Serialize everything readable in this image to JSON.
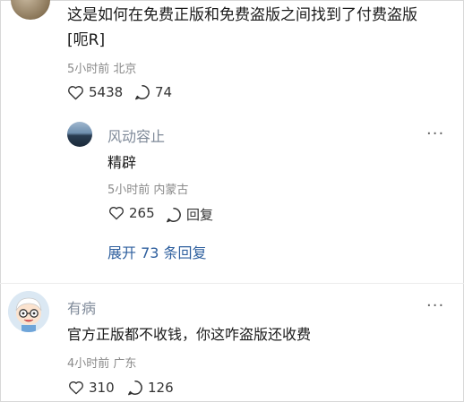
{
  "comments": [
    {
      "text_line1": "这是如何在免费正版和免费盗版之间找到了付费盗版",
      "text_line2": "[呃R]",
      "time": "5小时前",
      "location": "北京",
      "likes": "5438",
      "replies": "74"
    },
    {
      "username": "有病",
      "text": "官方正版都不收钱，你这咋盗版还收费",
      "time": "4小时前",
      "location": "广东",
      "likes": "310",
      "replies": "126"
    }
  ],
  "reply": {
    "username": "风动容止",
    "text": "精辟",
    "time": "5小时前",
    "location": "内蒙古",
    "likes": "265",
    "reply_label": "回复"
  },
  "expand_label": "展开 73 条回复",
  "more_label": "···",
  "icons": {
    "like": "heart-outline-icon",
    "comment": "speech-bubble-icon",
    "reply": "reply-bubble-icon"
  }
}
